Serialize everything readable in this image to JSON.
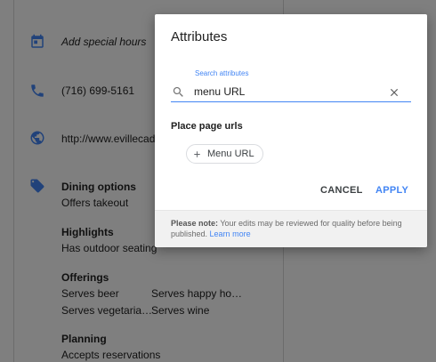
{
  "background": {
    "rows": [
      {
        "icon": "calendar-icon",
        "text": "Add special hours"
      },
      {
        "icon": "phone-icon",
        "text": "(716) 699-5161"
      },
      {
        "icon": "globe-icon",
        "text": "http://www.evillecadil"
      }
    ],
    "attributes_icon": "tag-icon",
    "sections": [
      {
        "heading": "Dining options",
        "items": [
          "Offers takeout"
        ]
      },
      {
        "heading": "Highlights",
        "items": [
          "Has outdoor seating"
        ]
      },
      {
        "heading": "Offerings",
        "items": [
          "Serves beer",
          "Serves happy ho…",
          "Serves vegetaria…",
          "Serves wine"
        ]
      },
      {
        "heading": "Planning",
        "items": [
          "Accepts reservations"
        ]
      }
    ],
    "accent_color": "#4285f4"
  },
  "dialog": {
    "title": "Attributes",
    "search": {
      "label": "Search attributes",
      "value": "menu URL",
      "placeholder": "Search attributes"
    },
    "section_title": "Place page urls",
    "chip_label": "Menu URL",
    "cancel_label": "CANCEL",
    "apply_label": "APPLY",
    "footer": {
      "note_label": "Please note:",
      "note_text": " Your edits may be reviewed for quality before being published. ",
      "link_text": "Learn more"
    }
  }
}
